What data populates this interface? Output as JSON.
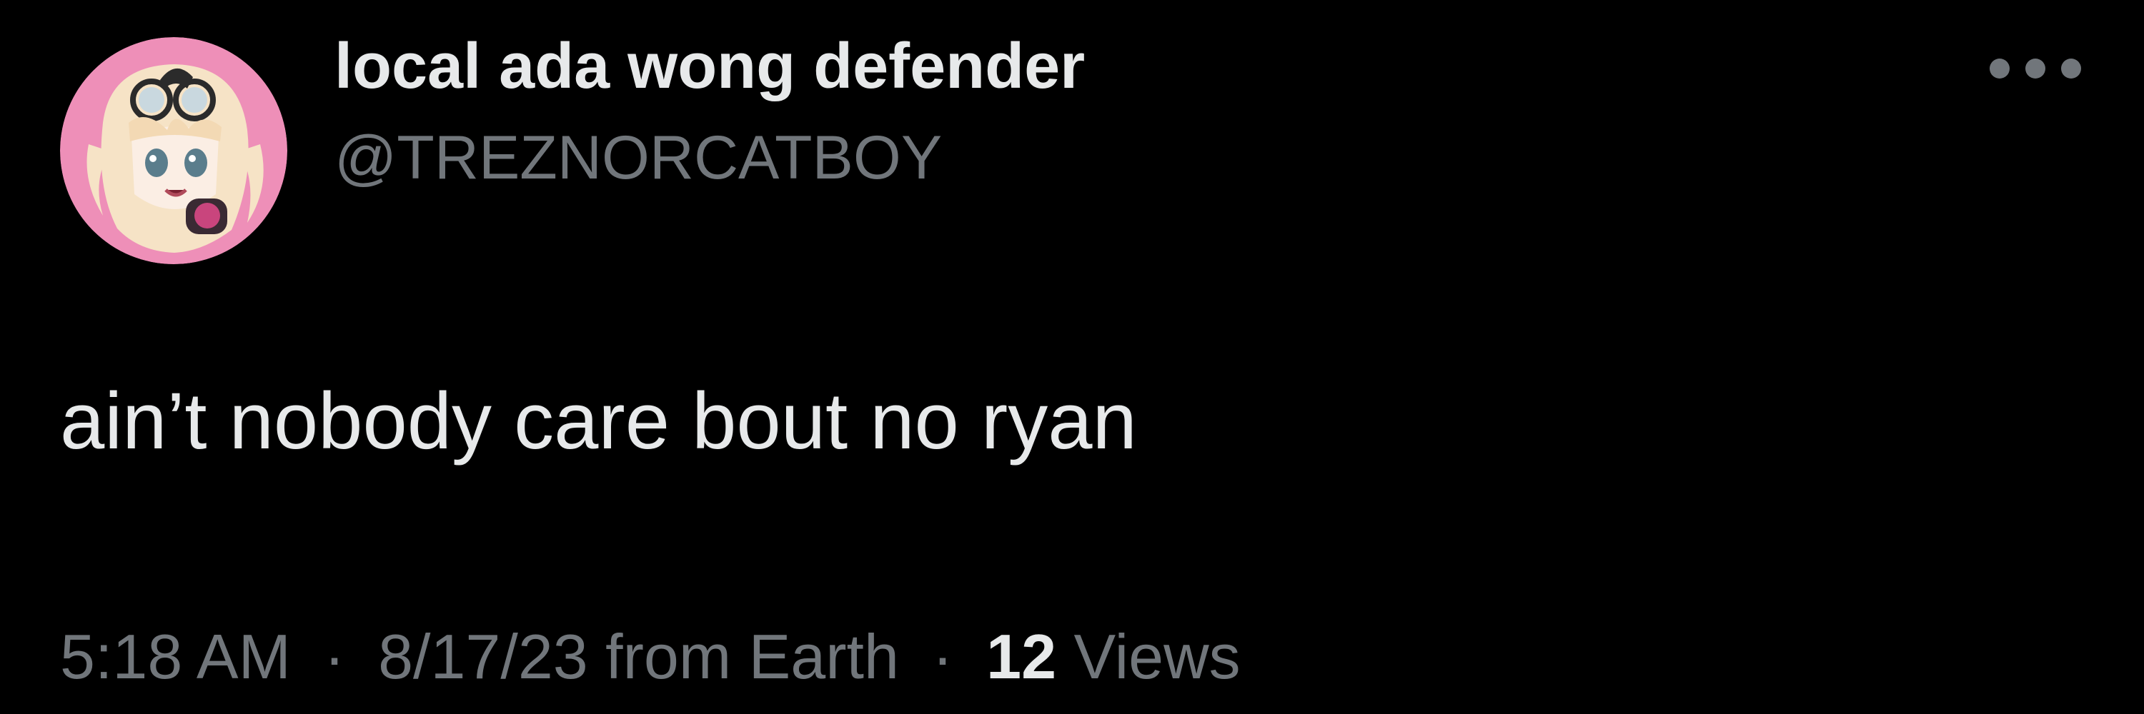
{
  "tweet": {
    "author": {
      "display_name": "local ada wong defender",
      "handle": "@TREZNORCATBOY",
      "avatar_icon": "anime-character-avatar-icon"
    },
    "more_icon": "ellipsis-icon",
    "text": "ain’t nobody care bout no ryan",
    "time": "5:18 AM",
    "date": "8/17/23",
    "source": "from Earth",
    "separator": "·",
    "views_count": "12",
    "views_label": "Views"
  },
  "colors": {
    "background": "#000000",
    "primary_text": "#e7e9ea",
    "secondary_text": "#71767b",
    "avatar_background": "#ee8fb8"
  }
}
